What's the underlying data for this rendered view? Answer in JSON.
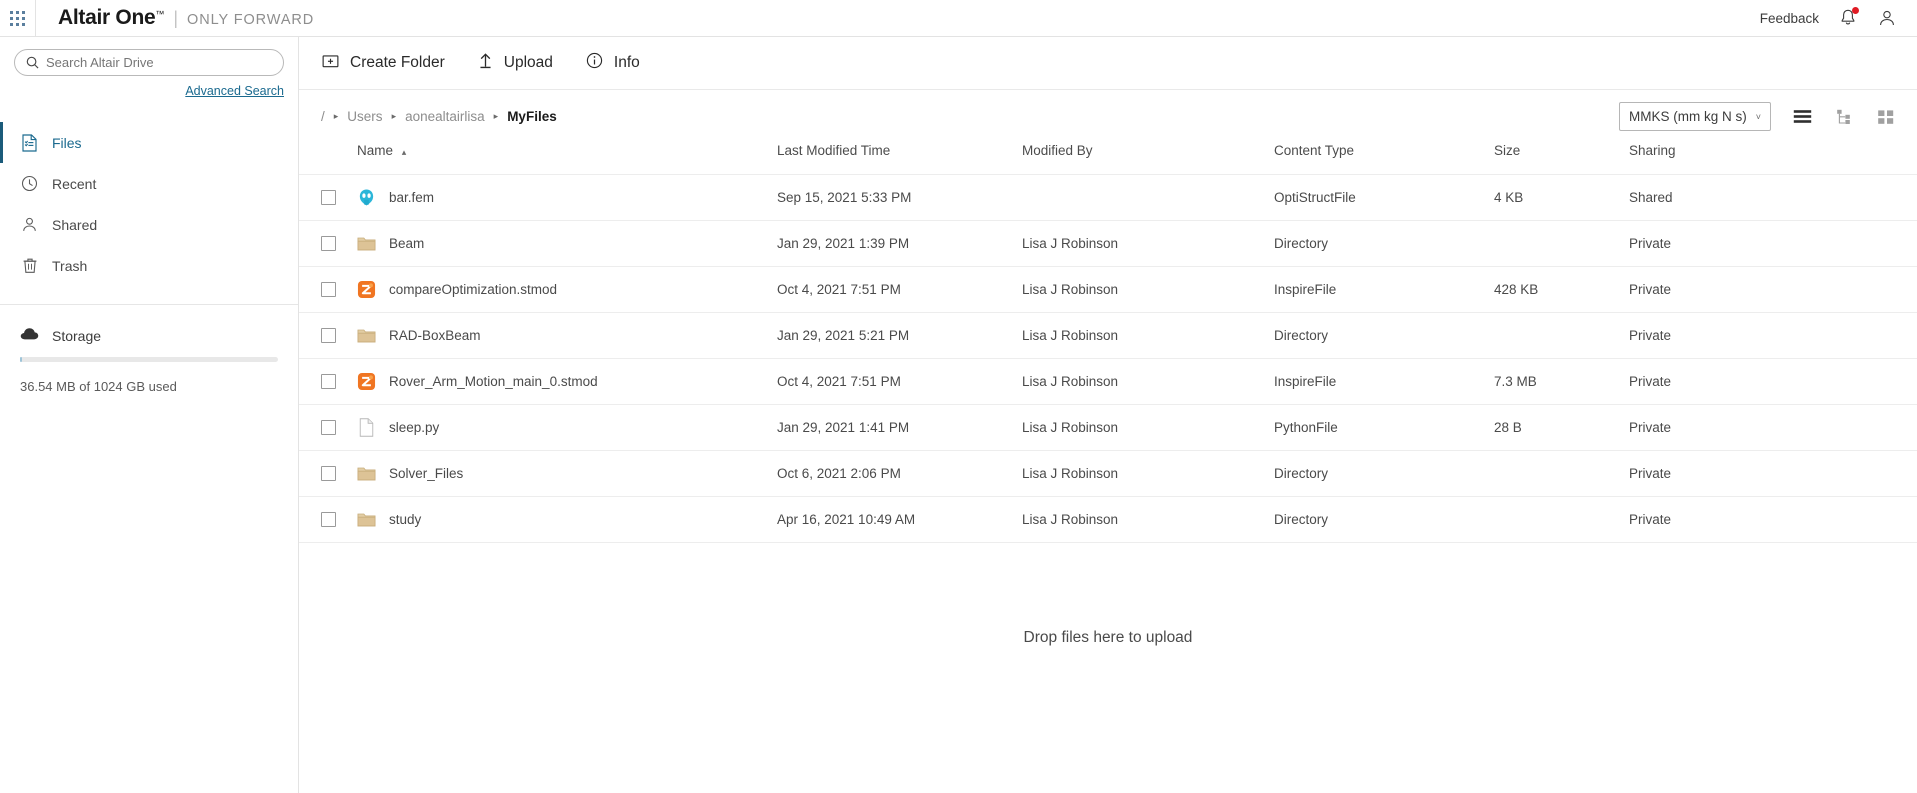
{
  "topbar": {
    "app_launcher_icon": "grid-dots-icon",
    "brand_name": "Altair One",
    "brand_tm": "™",
    "brand_separator": "|",
    "brand_tagline": "ONLY FORWARD",
    "feedback_label": "Feedback",
    "bell_icon": "notification-bell-icon",
    "account_icon": "user-account-icon",
    "notification_dot_color": "#e01b24"
  },
  "sidebar": {
    "search": {
      "placeholder": "Search Altair Drive",
      "value": "",
      "icon": "search-icon"
    },
    "advanced_search_label": "Advanced Search",
    "items": [
      {
        "label": "Files",
        "icon": "files-icon",
        "active": true
      },
      {
        "label": "Recent",
        "icon": "clock-icon",
        "active": false
      },
      {
        "label": "Shared",
        "icon": "person-icon",
        "active": false
      },
      {
        "label": "Trash",
        "icon": "trash-icon",
        "active": false
      }
    ],
    "storage": {
      "label": "Storage",
      "icon": "cloud-icon",
      "usage_text": "36.54 MB of 1024 GB used",
      "used_percent": 0.6
    }
  },
  "toolbar": {
    "create_folder_label": "Create Folder",
    "create_folder_icon": "folder-plus-icon",
    "upload_label": "Upload",
    "upload_icon": "upload-arrow-icon",
    "info_label": "Info",
    "info_icon": "info-circle-icon"
  },
  "breadcrumb": {
    "root": "/",
    "separator": "▸",
    "items": [
      "Users",
      "aonealtairlisa"
    ],
    "current": "MyFiles"
  },
  "view_controls": {
    "unit_system": "MMKS (mm kg N s)",
    "unit_chevron": "˅",
    "list_view_icon": "list-view-icon",
    "tree_view_icon": "tree-view-icon",
    "grid_view_icon": "grid-view-icon",
    "active_view": "list"
  },
  "table": {
    "columns": [
      {
        "key": "name",
        "label": "Name",
        "sort": "asc"
      },
      {
        "key": "date",
        "label": "Last Modified Time",
        "sort": ""
      },
      {
        "key": "by",
        "label": "Modified By",
        "sort": ""
      },
      {
        "key": "type",
        "label": "Content Type",
        "sort": ""
      },
      {
        "key": "size",
        "label": "Size",
        "sort": ""
      },
      {
        "key": "share",
        "label": "Sharing",
        "sort": ""
      }
    ],
    "sort_caret": "▴",
    "rows": [
      {
        "name": "bar.fem",
        "icon": "optistruct-file-icon",
        "date": "Sep 15, 2021 5:33 PM",
        "by": "",
        "type": "OptiStructFile",
        "size": "4 KB",
        "sharing": "Shared"
      },
      {
        "name": "Beam",
        "icon": "folder-icon",
        "date": "Jan 29, 2021 1:39 PM",
        "by": "Lisa J Robinson",
        "type": "Directory",
        "size": "",
        "sharing": "Private"
      },
      {
        "name": "compareOptimization.stmod",
        "icon": "inspire-file-icon",
        "date": "Oct 4, 2021 7:51 PM",
        "by": "Lisa J Robinson",
        "type": "InspireFile",
        "size": "428 KB",
        "sharing": "Private"
      },
      {
        "name": "RAD-BoxBeam",
        "icon": "folder-icon",
        "date": "Jan 29, 2021 5:21 PM",
        "by": "Lisa J Robinson",
        "type": "Directory",
        "size": "",
        "sharing": "Private"
      },
      {
        "name": "Rover_Arm_Motion_main_0.stmod",
        "icon": "inspire-file-icon",
        "date": "Oct 4, 2021 7:51 PM",
        "by": "Lisa J Robinson",
        "type": "InspireFile",
        "size": "7.3 MB",
        "sharing": "Private"
      },
      {
        "name": "sleep.py",
        "icon": "document-file-icon",
        "date": "Jan 29, 2021 1:41 PM",
        "by": "Lisa J Robinson",
        "type": "PythonFile",
        "size": "28 B",
        "sharing": "Private"
      },
      {
        "name": "Solver_Files",
        "icon": "folder-icon",
        "date": "Oct 6, 2021 2:06 PM",
        "by": "Lisa J Robinson",
        "type": "Directory",
        "size": "",
        "sharing": "Private"
      },
      {
        "name": "study",
        "icon": "folder-icon",
        "date": "Apr 16, 2021 10:49 AM",
        "by": "Lisa J Robinson",
        "type": "Directory",
        "size": "",
        "sharing": "Private"
      }
    ]
  },
  "dropzone": {
    "message": "Drop files here to upload"
  },
  "colors": {
    "accent_blue": "#1b6a8f",
    "folder": "#d9bd8c",
    "inspire_orange": "#f07522",
    "optistruct_cyan": "#2bb6d9",
    "notification_red": "#e01b24"
  }
}
